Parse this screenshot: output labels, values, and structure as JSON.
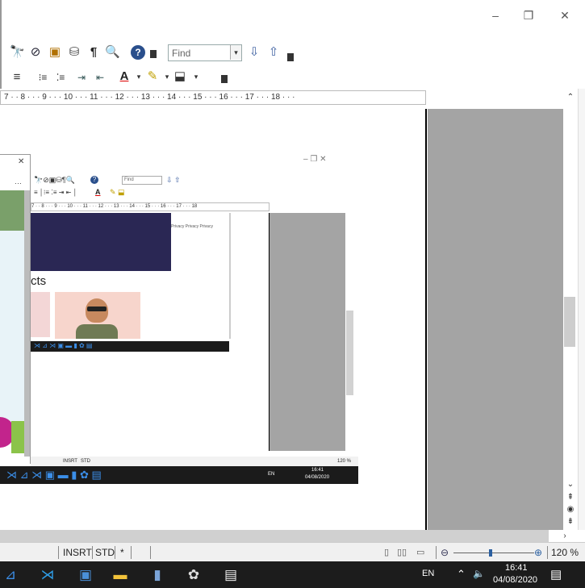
{
  "window": {
    "minimize_icon": "–",
    "maximize_icon": "❐",
    "close_icon": "✕"
  },
  "toolbar": {
    "find_placeholder": "Find"
  },
  "ruler": {
    "text": "7 · · 8 · · · 9 · · · 10 · · · 11 · · · 12 · · · 13 · · · 14 · · · 15 · · · 16 · · · 17 · · · 18 · · ·"
  },
  "nested": {
    "title_controls": "–    ❐    ✕",
    "find_placeholder": "Find",
    "ruler_text": "7 · · 8 · · · 9 · · · 10 · · · 11 · · · 12 · · · 13 · · · 14 · · · 15 · · · 16 · · · 17 · · · 18",
    "heading_fragment": "cts",
    "status_left": "INSRT",
    "status_mid": "STD",
    "zoom": "120 %",
    "taskbar_time": "16:41",
    "taskbar_date": "04/08/2020",
    "taskbar_lang": "EN",
    "privacy_links": "Privacy  Privacy  Privacy"
  },
  "statusbar": {
    "insert_mode": "INSRT",
    "selection_mode": "STD",
    "modified": "*",
    "zoom": "120 %"
  },
  "taskbar": {
    "language": "EN",
    "time": "16:41",
    "date": "04/08/2020"
  }
}
